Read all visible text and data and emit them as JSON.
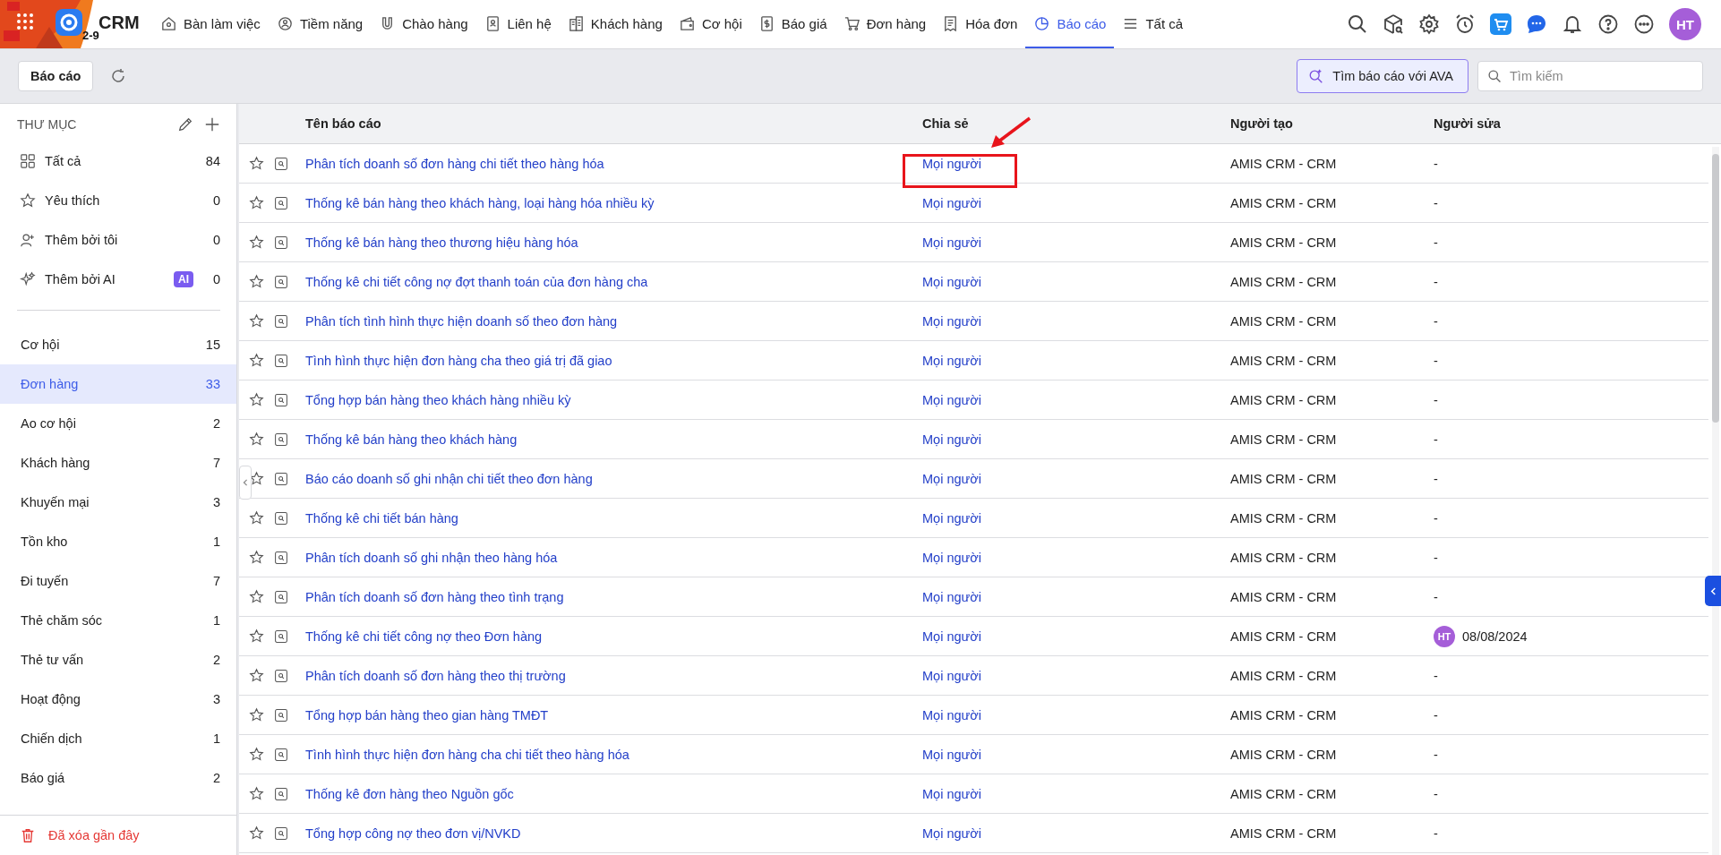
{
  "brand": {
    "name": "CRM",
    "badge": "2-9"
  },
  "nav": [
    {
      "label": "Bàn làm việc",
      "selected": false
    },
    {
      "label": "Tiềm năng",
      "selected": false
    },
    {
      "label": "Chào hàng",
      "selected": false
    },
    {
      "label": "Liên hệ",
      "selected": false
    },
    {
      "label": "Khách hàng",
      "selected": false
    },
    {
      "label": "Cơ hội",
      "selected": false
    },
    {
      "label": "Báo giá",
      "selected": false
    },
    {
      "label": "Đơn hàng",
      "selected": false
    },
    {
      "label": "Hóa đơn",
      "selected": false
    },
    {
      "label": "Báo cáo",
      "selected": true
    },
    {
      "label": "Tất cả",
      "selected": false
    }
  ],
  "user": {
    "initials": "HT"
  },
  "toolbar": {
    "title": "Báo cáo",
    "ava_button": "Tìm báo cáo với AVA",
    "search": {
      "placeholder": "Tìm kiếm"
    }
  },
  "sidebar": {
    "header": "THƯ MỤC",
    "quick": [
      {
        "label": "Tất cả",
        "count": "84",
        "selected": false
      },
      {
        "label": "Yêu thích",
        "count": "0",
        "selected": false
      },
      {
        "label": "Thêm bởi tôi",
        "count": "0",
        "selected": false
      },
      {
        "label": "Thêm bởi AI",
        "badge": "AI",
        "count": "0",
        "selected": false
      }
    ],
    "folders": [
      {
        "label": "Cơ hội",
        "count": "15",
        "selected": false
      },
      {
        "label": "Đơn hàng",
        "count": "33",
        "selected": true
      },
      {
        "label": "Ao cơ hội",
        "count": "2",
        "selected": false
      },
      {
        "label": "Khách hàng",
        "count": "7",
        "selected": false
      },
      {
        "label": "Khuyến mại",
        "count": "3",
        "selected": false
      },
      {
        "label": "Tồn kho",
        "count": "1",
        "selected": false
      },
      {
        "label": "Đi tuyến",
        "count": "7",
        "selected": false
      },
      {
        "label": "Thẻ chăm sóc",
        "count": "1",
        "selected": false
      },
      {
        "label": "Thẻ tư vấn",
        "count": "2",
        "selected": false
      },
      {
        "label": "Hoạt động",
        "count": "3",
        "selected": false
      },
      {
        "label": "Chiến dịch",
        "count": "1",
        "selected": false
      },
      {
        "label": "Báo giá",
        "count": "2",
        "selected": false
      }
    ],
    "trash": "Đã xóa gần đây"
  },
  "table": {
    "columns": [
      "Tên báo cáo",
      "Chia sẻ",
      "Người tạo",
      "Người sửa"
    ],
    "rows": [
      {
        "name": "Phân tích doanh số đơn hàng chi tiết theo hàng hóa",
        "share": "Mọi người",
        "creator": "AMIS CRM - CRM",
        "editor": {
          "text": "-"
        },
        "favorite": false,
        "annotated": true
      },
      {
        "name": "Thống kê bán hàng theo khách hàng, loại hàng hóa nhiều kỳ",
        "share": "Mọi người",
        "creator": "AMIS CRM - CRM",
        "editor": {
          "text": "-"
        },
        "favorite": false,
        "annotated": false
      },
      {
        "name": "Thống kê bán hàng theo thương hiệu hàng hóa",
        "share": "Mọi người",
        "creator": "AMIS CRM - CRM",
        "editor": {
          "text": "-"
        },
        "favorite": false,
        "annotated": false
      },
      {
        "name": "Thống kê chi tiết công nợ đợt thanh toán của đơn hàng cha",
        "share": "Mọi người",
        "creator": "AMIS CRM - CRM",
        "editor": {
          "text": "-"
        },
        "favorite": false,
        "annotated": false
      },
      {
        "name": "Phân tích tình hình thực hiện doanh số theo đơn hàng",
        "share": "Mọi người",
        "creator": "AMIS CRM - CRM",
        "editor": {
          "text": "-"
        },
        "favorite": false,
        "annotated": false
      },
      {
        "name": "Tình hình thực hiện đơn hàng cha theo giá trị đã giao",
        "share": "Mọi người",
        "creator": "AMIS CRM - CRM",
        "editor": {
          "text": "-"
        },
        "favorite": false,
        "annotated": false
      },
      {
        "name": "Tổng hợp bán hàng theo khách hàng nhiều kỳ",
        "share": "Mọi người",
        "creator": "AMIS CRM - CRM",
        "editor": {
          "text": "-"
        },
        "favorite": false,
        "annotated": false
      },
      {
        "name": "Thống kê bán hàng theo khách hàng",
        "share": "Mọi người",
        "creator": "AMIS CRM - CRM",
        "editor": {
          "text": "-"
        },
        "favorite": false,
        "annotated": false
      },
      {
        "name": "Báo cáo doanh số ghi nhận chi tiết theo đơn hàng",
        "share": "Mọi người",
        "creator": "AMIS CRM - CRM",
        "editor": {
          "text": "-"
        },
        "favorite": false,
        "annotated": false
      },
      {
        "name": "Thống kê chi tiết bán hàng",
        "share": "Mọi người",
        "creator": "AMIS CRM - CRM",
        "editor": {
          "text": "-"
        },
        "favorite": false,
        "annotated": false
      },
      {
        "name": "Phân tích doanh số ghi nhận theo hàng hóa",
        "share": "Mọi người",
        "creator": "AMIS CRM - CRM",
        "editor": {
          "text": "-"
        },
        "favorite": false,
        "annotated": false
      },
      {
        "name": "Phân tích doanh số đơn hàng theo tình trạng",
        "share": "Mọi người",
        "creator": "AMIS CRM - CRM",
        "editor": {
          "text": "-"
        },
        "favorite": false,
        "annotated": false
      },
      {
        "name": "Thống kê chi tiết công nợ theo Đơn hàng",
        "share": "Mọi người",
        "creator": "AMIS CRM - CRM",
        "editor": {
          "avatar": "HT",
          "text": "08/08/2024"
        },
        "favorite": false,
        "annotated": false
      },
      {
        "name": "Phân tích doanh số đơn hàng theo thị trường",
        "share": "Mọi người",
        "creator": "AMIS CRM - CRM",
        "editor": {
          "text": "-"
        },
        "favorite": false,
        "annotated": false
      },
      {
        "name": "Tổng hợp bán hàng theo gian hàng TMĐT",
        "share": "Mọi người",
        "creator": "AMIS CRM - CRM",
        "editor": {
          "text": "-"
        },
        "favorite": false,
        "annotated": false
      },
      {
        "name": "Tình hình thực hiện đơn hàng cha chi tiết theo hàng hóa",
        "share": "Mọi người",
        "creator": "AMIS CRM - CRM",
        "editor": {
          "text": "-"
        },
        "favorite": false,
        "annotated": false
      },
      {
        "name": "Thống kê đơn hàng theo Nguồn gốc",
        "share": "Mọi người",
        "creator": "AMIS CRM - CRM",
        "editor": {
          "text": "-"
        },
        "favorite": false,
        "annotated": false
      },
      {
        "name": "Tổng hợp công nợ theo đơn vị/NVKD",
        "share": "Mọi người",
        "creator": "AMIS CRM - CRM",
        "editor": {
          "text": "-"
        },
        "favorite": false,
        "annotated": false
      }
    ]
  }
}
